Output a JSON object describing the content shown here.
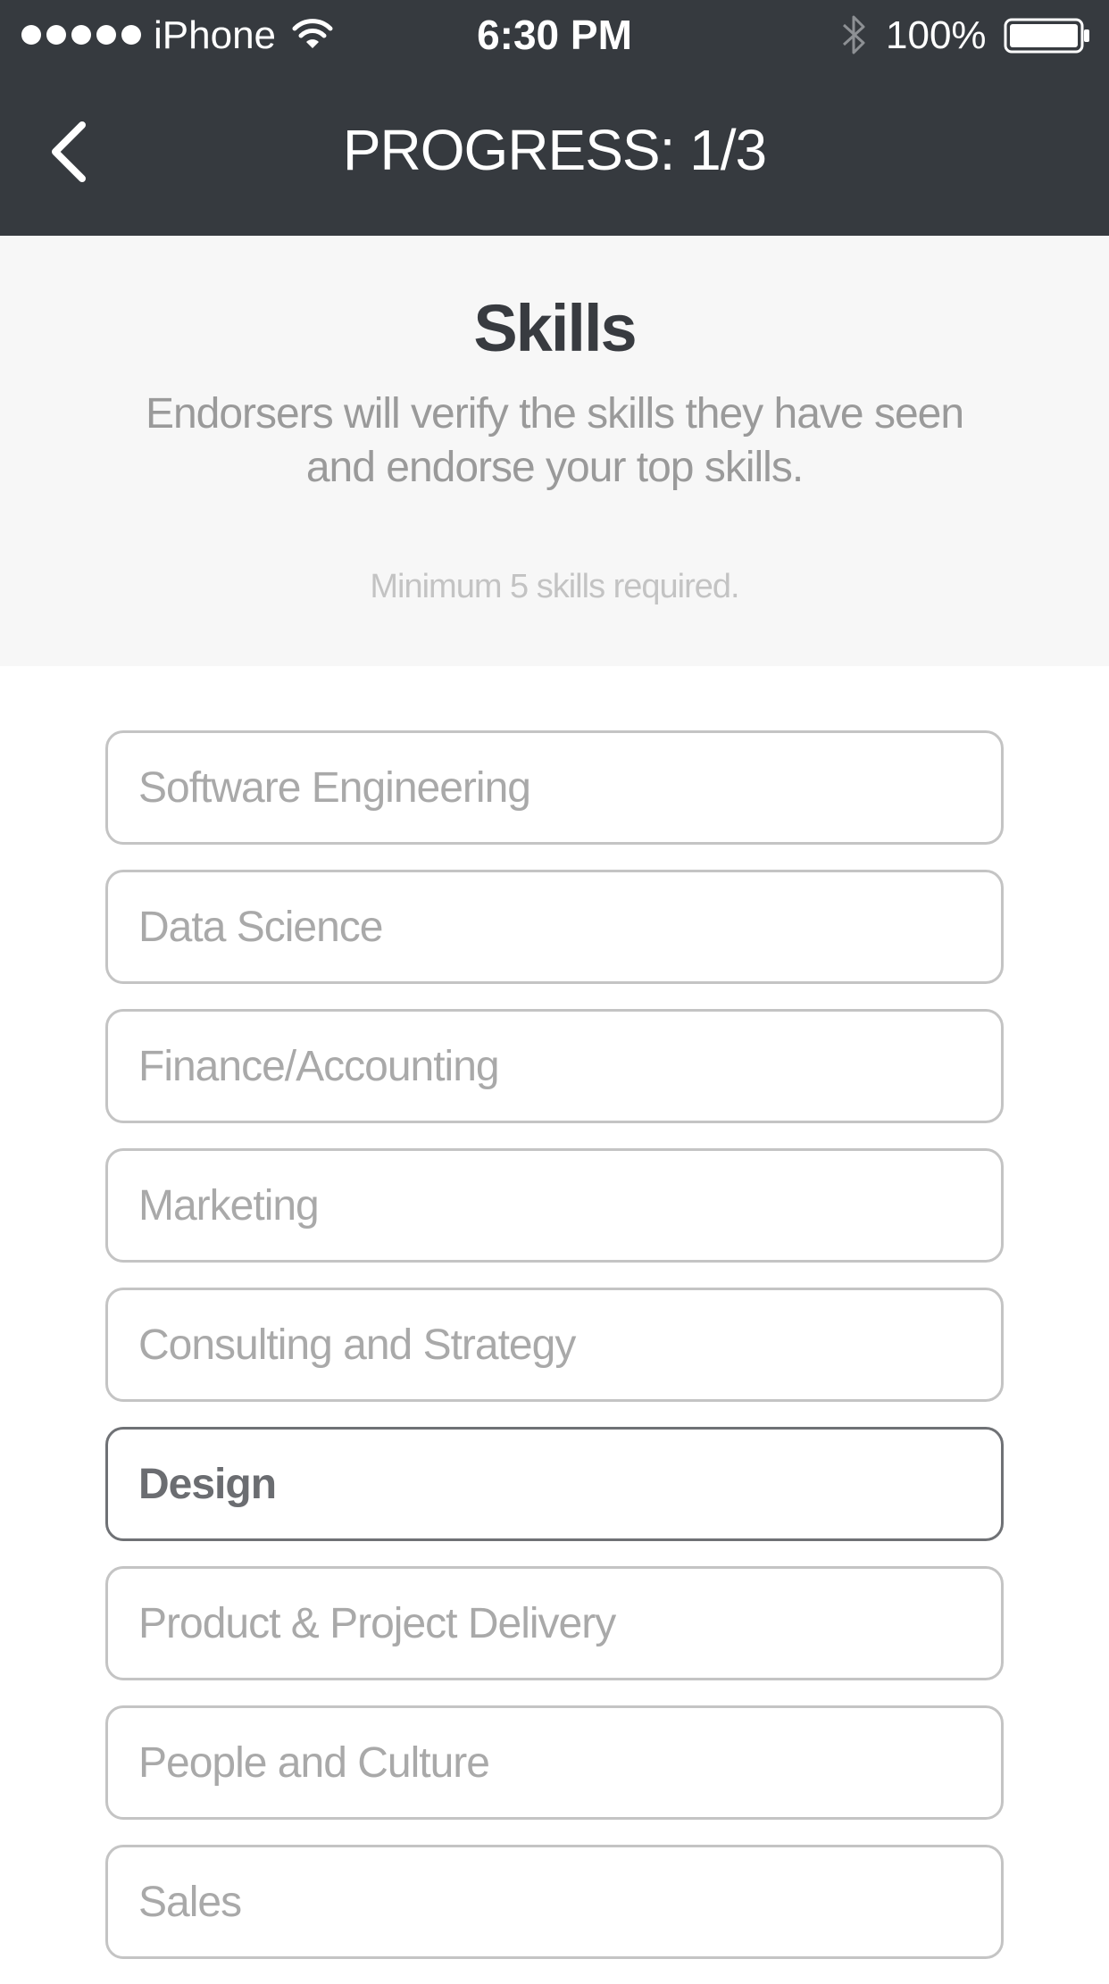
{
  "status_bar": {
    "carrier": "iPhone",
    "time": "6:30 PM",
    "battery": "100%",
    "signal_icon": "signal-dots-icon",
    "wifi_icon": "wifi-icon",
    "bluetooth_icon": "bluetooth-icon",
    "battery_icon": "battery-icon"
  },
  "nav": {
    "back_icon": "chevron-left-icon",
    "title": "PROGRESS: 1/3"
  },
  "intro": {
    "title": "Skills",
    "description": "Endorsers will verify the skills they have seen and endorse your top skills.",
    "note": "Minimum 5 skills required."
  },
  "skills": [
    {
      "label": "Software Engineering",
      "selected": false
    },
    {
      "label": "Data Science",
      "selected": false
    },
    {
      "label": "Finance/Accounting",
      "selected": false
    },
    {
      "label": "Marketing",
      "selected": false
    },
    {
      "label": "Consulting and Strategy",
      "selected": false
    },
    {
      "label": "Design",
      "selected": true
    },
    {
      "label": "Product & Project Delivery",
      "selected": false
    },
    {
      "label": "People and Culture",
      "selected": false
    },
    {
      "label": "Sales",
      "selected": false
    }
  ],
  "colors": {
    "header_bg": "#363a3f",
    "intro_bg": "#f7f7f7",
    "title_text": "#383b40",
    "muted_text": "#9a9a9a",
    "note_text": "#c3c3c3",
    "item_border": "#c4c4c4",
    "item_border_selected": "#6f7175"
  }
}
